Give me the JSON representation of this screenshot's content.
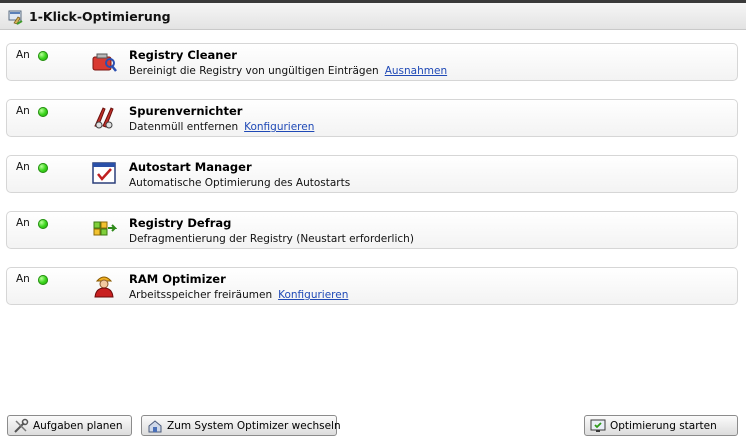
{
  "header": {
    "title": "1-Klick-Optimierung",
    "icon": "broom-icon"
  },
  "rows": [
    {
      "status": "An",
      "title": "Registry Cleaner",
      "desc": "Bereinigt die Registry von ungültigen Einträgen",
      "link": "Ausnahmen",
      "icon": "registry-cleaner-icon"
    },
    {
      "status": "An",
      "title": "Spurenvernichter",
      "desc": "Datenmüll entfernen",
      "link": "Konfigurieren",
      "icon": "trace-eraser-icon"
    },
    {
      "status": "An",
      "title": "Autostart Manager",
      "desc": "Automatische Optimierung des Autostarts",
      "link": "",
      "icon": "autostart-icon"
    },
    {
      "status": "An",
      "title": "Registry Defrag",
      "desc": "Defragmentierung der Registry (Neustart erforderlich)",
      "link": "",
      "icon": "defrag-icon"
    },
    {
      "status": "An",
      "title": "RAM Optimizer",
      "desc": "Arbeitsspeicher freiräumen",
      "link": "Konfigurieren",
      "icon": "worker-icon"
    }
  ],
  "footer": {
    "schedule_label": "Aufgaben planen",
    "switch_label": "Zum System Optimizer  wechseln",
    "start_label": "Optimierung starten"
  },
  "colors": {
    "status_dot": "#3bd61c",
    "link": "#1f49b6"
  }
}
